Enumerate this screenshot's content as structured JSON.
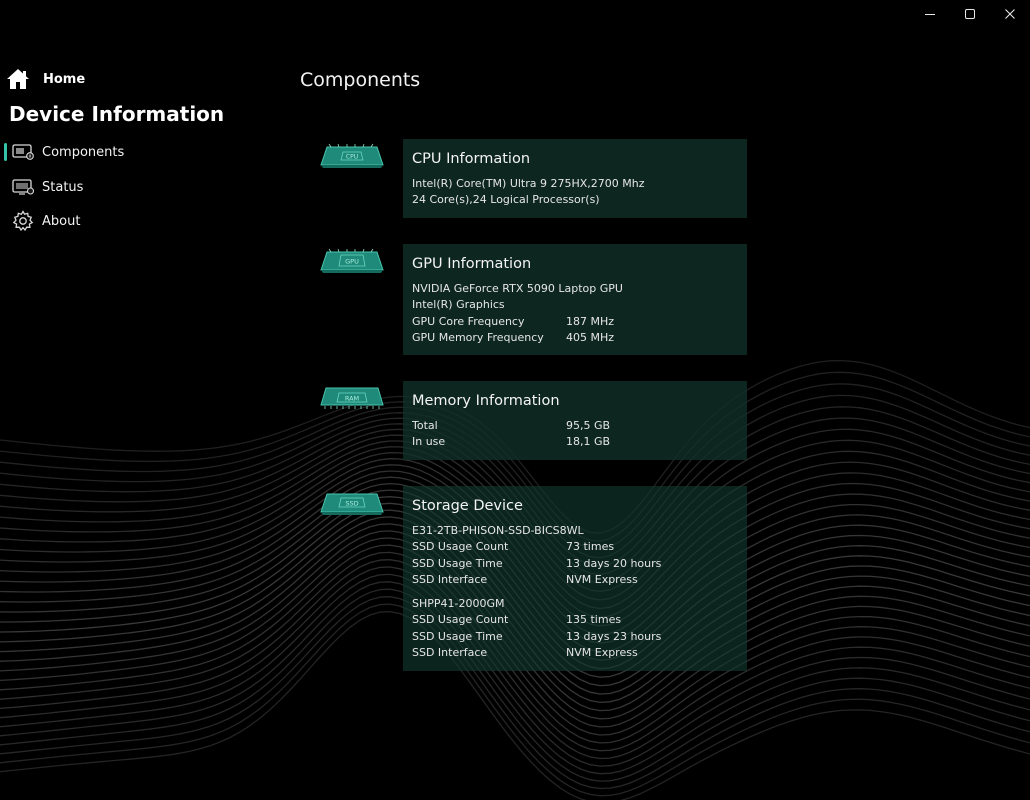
{
  "window": {
    "minimize_icon": "minimize-icon",
    "maximize_icon": "maximize-icon",
    "close_icon": "close-icon"
  },
  "sidebar": {
    "home_label": "Home",
    "section_title": "Device Information",
    "items": [
      {
        "label": "Components",
        "icon": "components-icon",
        "active": true
      },
      {
        "label": "Status",
        "icon": "status-icon",
        "active": false
      },
      {
        "label": "About",
        "icon": "gear-icon",
        "active": false
      }
    ]
  },
  "page": {
    "title": "Components"
  },
  "cpu": {
    "icon_text": "CPU",
    "title": "CPU Information",
    "lines": [
      "Intel(R) Core(TM) Ultra 9 275HX,2700 Mhz",
      "24 Core(s),24 Logical Processor(s)"
    ]
  },
  "gpu": {
    "icon_text": "GPU",
    "title": "GPU Information",
    "lines": [
      "NVIDIA GeForce RTX 5090 Laptop GPU",
      "Intel(R) Graphics"
    ],
    "rows": [
      {
        "k": "GPU Core Frequency",
        "v": "187 MHz"
      },
      {
        "k": "GPU Memory Frequency",
        "v": "405 MHz"
      }
    ]
  },
  "memory": {
    "icon_text": "RAM",
    "title": "Memory Information",
    "rows": [
      {
        "k": "Total",
        "v": "95,5 GB"
      },
      {
        "k": "In use",
        "v": "18,1 GB"
      }
    ]
  },
  "storage": {
    "icon_text": "SSD",
    "title": "Storage Device",
    "devices": [
      {
        "name": "E31-2TB-PHISON-SSD-BICS8WL",
        "rows": [
          {
            "k": "SSD Usage Count",
            "v": "73 times"
          },
          {
            "k": "SSD Usage Time",
            "v": "13 days 20 hours"
          },
          {
            "k": "SSD Interface",
            "v": "NVM Express"
          }
        ]
      },
      {
        "name": "SHPP41-2000GM",
        "rows": [
          {
            "k": "SSD Usage Count",
            "v": "135 times"
          },
          {
            "k": "SSD Usage Time",
            "v": "13 days 23 hours"
          },
          {
            "k": "SSD Interface",
            "v": "NVM Express"
          }
        ]
      }
    ]
  },
  "colors": {
    "accent": "#34c3a6",
    "card_bg": "#113129",
    "chip": "#1f8a7a"
  }
}
